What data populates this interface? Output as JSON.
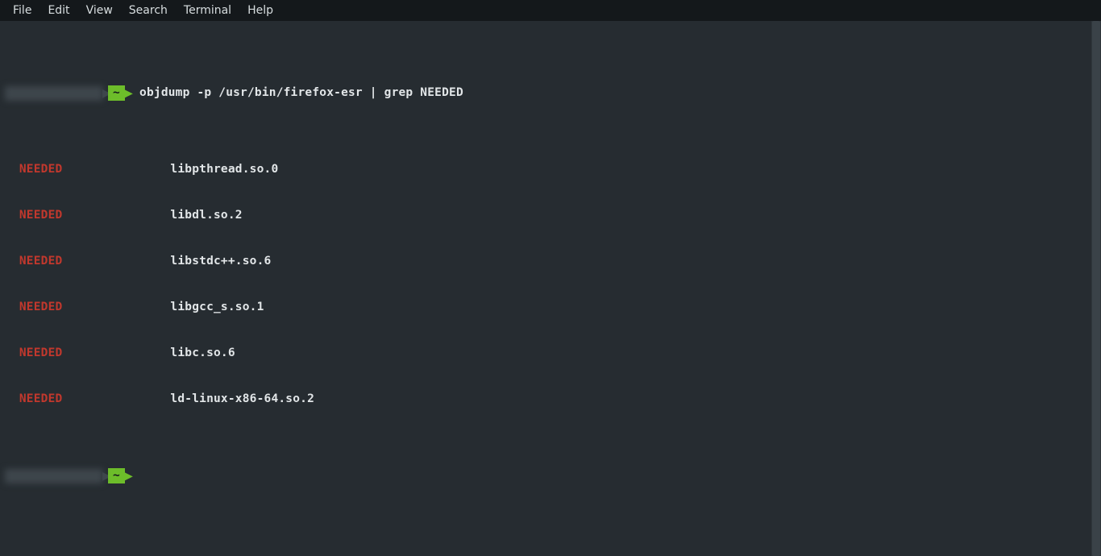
{
  "menubar": {
    "items": [
      "File",
      "Edit",
      "View",
      "Search",
      "Terminal",
      "Help"
    ]
  },
  "prompt": {
    "tilde": "~",
    "command": "objdump -p /usr/bin/firefox-esr | grep NEEDED"
  },
  "output": {
    "lines": [
      {
        "tag": "NEEDED",
        "lib": "libpthread.so.0"
      },
      {
        "tag": "NEEDED",
        "lib": "libdl.so.2"
      },
      {
        "tag": "NEEDED",
        "lib": "libstdc++.so.6"
      },
      {
        "tag": "NEEDED",
        "lib": "libgcc_s.so.1"
      },
      {
        "tag": "NEEDED",
        "lib": "libc.so.6"
      },
      {
        "tag": "NEEDED",
        "lib": "ld-linux-x86-64.so.2"
      }
    ]
  },
  "prompt2": {
    "tilde": "~"
  }
}
